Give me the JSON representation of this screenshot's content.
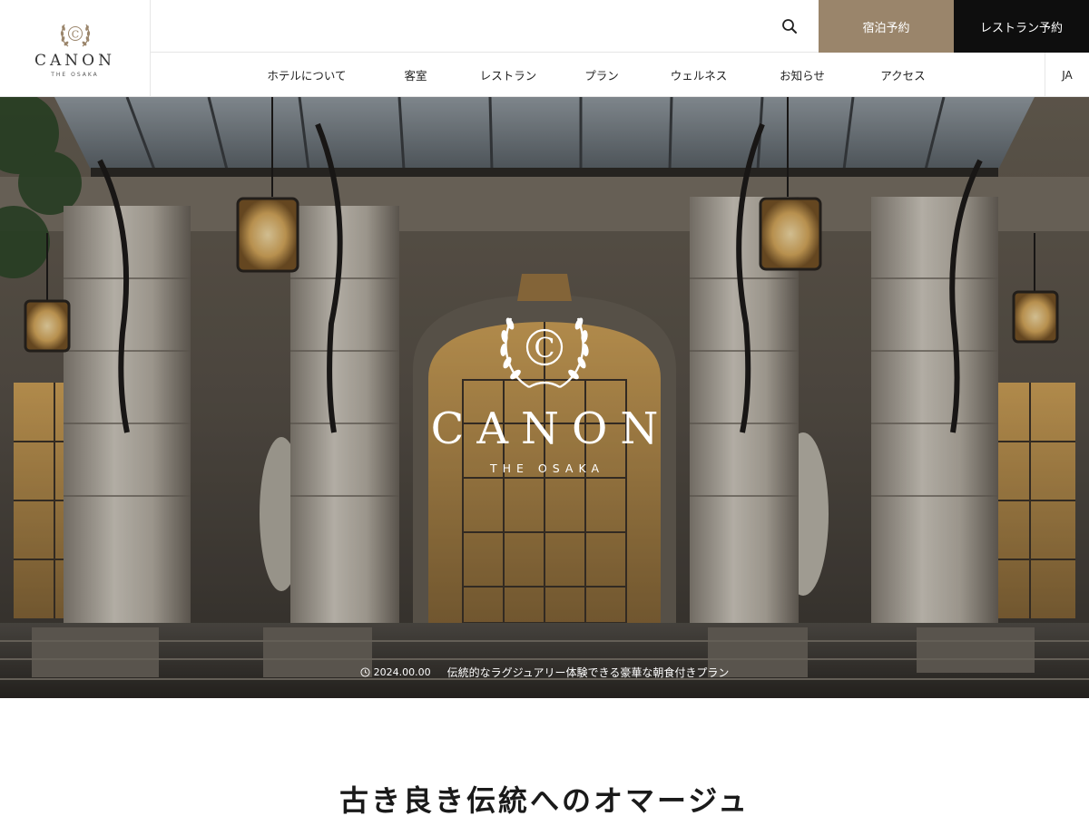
{
  "header": {
    "logo": {
      "name": "CANON",
      "sub": "THE OSAKA",
      "emblem_letter": "C"
    },
    "search_icon": "search-icon",
    "stay_button": "宿泊予約",
    "restaurant_button": "レストラン予約",
    "nav": [
      "ホテルについて",
      "客室",
      "レストラン",
      "プラン",
      "ウェルネス",
      "お知らせ",
      "アクセス"
    ],
    "lang": "JA"
  },
  "hero": {
    "logo": {
      "name": "CANON",
      "sub": "THE OSAKA",
      "emblem_letter": "C"
    },
    "news": {
      "date": "2024.00.00",
      "title": "伝統的なラグジュアリー体験できる豪華な朝食付きプラン",
      "icon": "clock-icon"
    }
  },
  "intro": {
    "title": "古き良き伝統へのオマージュ"
  },
  "colors": {
    "accent_gold": "#9a856b",
    "dark": "#0e0e0e",
    "border": "#e6e6e6"
  }
}
